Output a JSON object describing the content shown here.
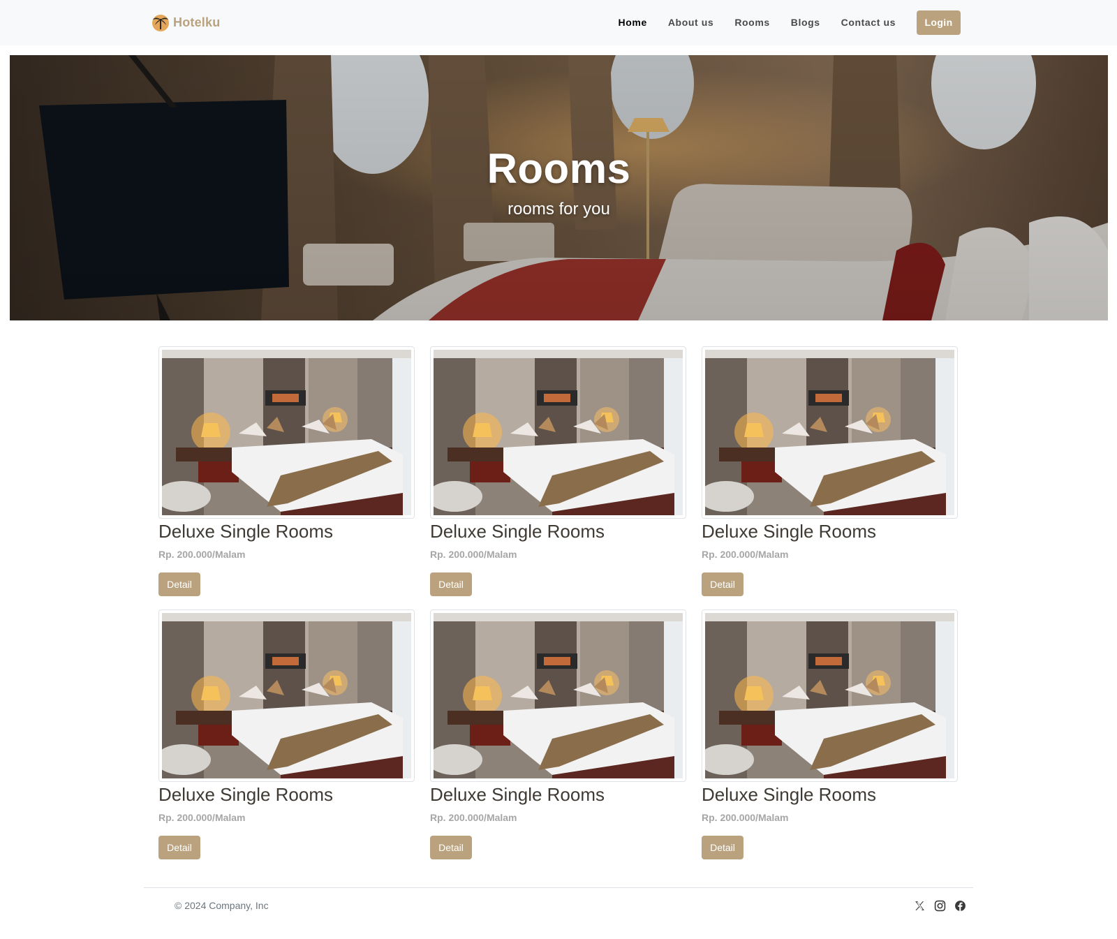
{
  "brand": {
    "name": "Hotelku"
  },
  "nav": {
    "links": [
      {
        "label": "Home",
        "active": true
      },
      {
        "label": "About us",
        "active": false
      },
      {
        "label": "Rooms",
        "active": false
      },
      {
        "label": "Blogs",
        "active": false
      },
      {
        "label": "Contact us",
        "active": false
      }
    ],
    "login_label": "Login"
  },
  "hero": {
    "title": "Rooms",
    "subtitle": "rooms for you"
  },
  "rooms": [
    {
      "title": "Deluxe Single Rooms",
      "price": "Rp. 200.000/Malam",
      "button": "Detail"
    },
    {
      "title": "Deluxe Single Rooms",
      "price": "Rp. 200.000/Malam",
      "button": "Detail"
    },
    {
      "title": "Deluxe Single Rooms",
      "price": "Rp. 200.000/Malam",
      "button": "Detail"
    },
    {
      "title": "Deluxe Single Rooms",
      "price": "Rp. 200.000/Malam",
      "button": "Detail"
    },
    {
      "title": "Deluxe Single Rooms",
      "price": "Rp. 200.000/Malam",
      "button": "Detail"
    },
    {
      "title": "Deluxe Single Rooms",
      "price": "Rp. 200.000/Malam",
      "button": "Detail"
    }
  ],
  "footer": {
    "copyright": "© 2024 Company, Inc",
    "social": [
      "x-icon",
      "instagram-icon",
      "facebook-icon"
    ]
  },
  "colors": {
    "accent": "#b9a27d",
    "navbar_bg": "#f8f9fa",
    "text": "#3f3a34",
    "muted": "#a6a6a6"
  }
}
